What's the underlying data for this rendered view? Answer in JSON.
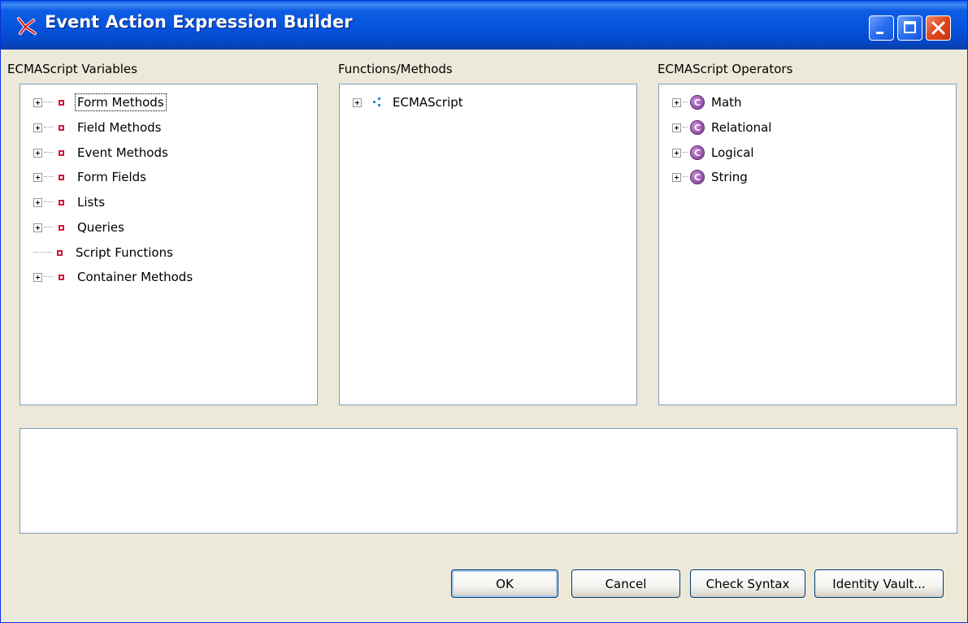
{
  "window": {
    "title": "Event Action Expression Builder",
    "title_bar_color": "#0553dd",
    "icons": {
      "app": "app-logo-icon",
      "minimize": "minimize-icon",
      "maximize": "maximize-icon",
      "close": "close-icon"
    }
  },
  "variables_panel": {
    "label": "ECMAScript Variables",
    "items": [
      {
        "label": "Form Methods",
        "expandable": true,
        "focused": true
      },
      {
        "label": "Field Methods",
        "expandable": true
      },
      {
        "label": "Event Methods",
        "expandable": true
      },
      {
        "label": "Form Fields",
        "expandable": true
      },
      {
        "label": "Lists",
        "expandable": true
      },
      {
        "label": "Queries",
        "expandable": true
      },
      {
        "label": "Script Functions",
        "expandable": false
      },
      {
        "label": "Container Methods",
        "expandable": true
      }
    ]
  },
  "functions_panel": {
    "label": "Functions/Methods",
    "items": [
      {
        "label": "ECMAScript",
        "expandable": true
      }
    ]
  },
  "operators_panel": {
    "label": "ECMAScript Operators",
    "icon_letter": "C",
    "items": [
      {
        "label": "Math"
      },
      {
        "label": "Relational"
      },
      {
        "label": "Logical"
      },
      {
        "label": "String"
      }
    ]
  },
  "expression": {
    "value": ""
  },
  "buttons": {
    "ok": "OK",
    "cancel": "Cancel",
    "check_syntax": "Check Syntax",
    "identity_vault": "Identity Vault..."
  }
}
